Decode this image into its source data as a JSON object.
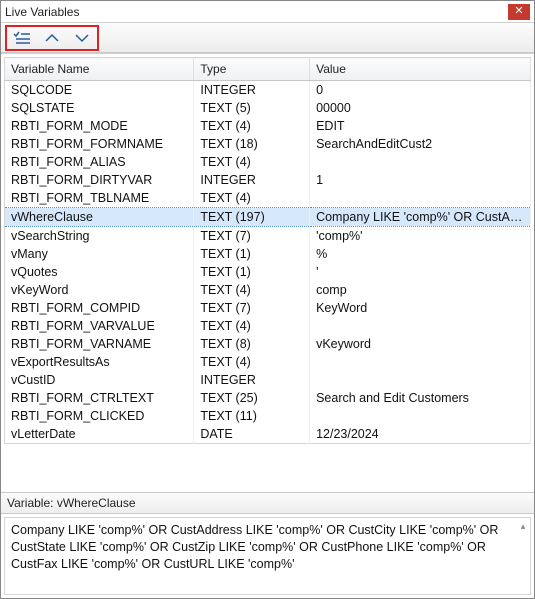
{
  "window": {
    "title": "Live Variables"
  },
  "columns": {
    "name": "Variable Name",
    "type": "Type",
    "value": "Value"
  },
  "rows": [
    {
      "name": "SQLCODE",
      "type": "INTEGER",
      "value": "0",
      "selected": false
    },
    {
      "name": "SQLSTATE",
      "type": "TEXT (5)",
      "value": "00000",
      "selected": false
    },
    {
      "name": "RBTI_FORM_MODE",
      "type": "TEXT (4)",
      "value": "EDIT",
      "selected": false
    },
    {
      "name": "RBTI_FORM_FORMNAME",
      "type": "TEXT (18)",
      "value": "SearchAndEditCust2",
      "selected": false
    },
    {
      "name": "RBTI_FORM_ALIAS",
      "type": "TEXT (4)",
      "value": "",
      "selected": false
    },
    {
      "name": "RBTI_FORM_DIRTYVAR",
      "type": "INTEGER",
      "value": "1",
      "selected": false
    },
    {
      "name": "RBTI_FORM_TBLNAME",
      "type": "TEXT (4)",
      "value": "",
      "selected": false
    },
    {
      "name": "vWhereClause",
      "type": "TEXT (197)",
      "value": "Company LIKE 'comp%' OR CustAdd...",
      "selected": true
    },
    {
      "name": "vSearchString",
      "type": "TEXT (7)",
      "value": "'comp%'",
      "selected": false
    },
    {
      "name": "vMany",
      "type": "TEXT (1)",
      "value": "%",
      "selected": false
    },
    {
      "name": "vQuotes",
      "type": "TEXT (1)",
      "value": "'",
      "selected": false
    },
    {
      "name": "vKeyWord",
      "type": "TEXT (4)",
      "value": "comp",
      "selected": false
    },
    {
      "name": "RBTI_FORM_COMPID",
      "type": "TEXT (7)",
      "value": "KeyWord",
      "selected": false
    },
    {
      "name": "RBTI_FORM_VARVALUE",
      "type": "TEXT (4)",
      "value": "",
      "selected": false
    },
    {
      "name": "RBTI_FORM_VARNAME",
      "type": "TEXT (8)",
      "value": "vKeyword",
      "selected": false
    },
    {
      "name": "vExportResultsAs",
      "type": "TEXT (4)",
      "value": "",
      "selected": false
    },
    {
      "name": "vCustID",
      "type": "INTEGER",
      "value": "",
      "selected": false
    },
    {
      "name": "RBTI_FORM_CTRLTEXT",
      "type": "TEXT (25)",
      "value": "Search and Edit Customers",
      "selected": false
    },
    {
      "name": "RBTI_FORM_CLICKED",
      "type": "TEXT (11)",
      "value": "",
      "selected": false
    },
    {
      "name": "vLetterDate",
      "type": "DATE",
      "value": "12/23/2024",
      "selected": false
    }
  ],
  "detail": {
    "label_prefix": "Variable: ",
    "selected_name": "vWhereClause",
    "text": "Company LIKE 'comp%' OR CustAddress LIKE 'comp%' OR CustCity LIKE 'comp%' OR CustState LIKE 'comp%' OR CustZip LIKE 'comp%' OR CustPhone LIKE 'comp%' OR CustFax LIKE 'comp%' OR CustURL LIKE 'comp%'"
  }
}
